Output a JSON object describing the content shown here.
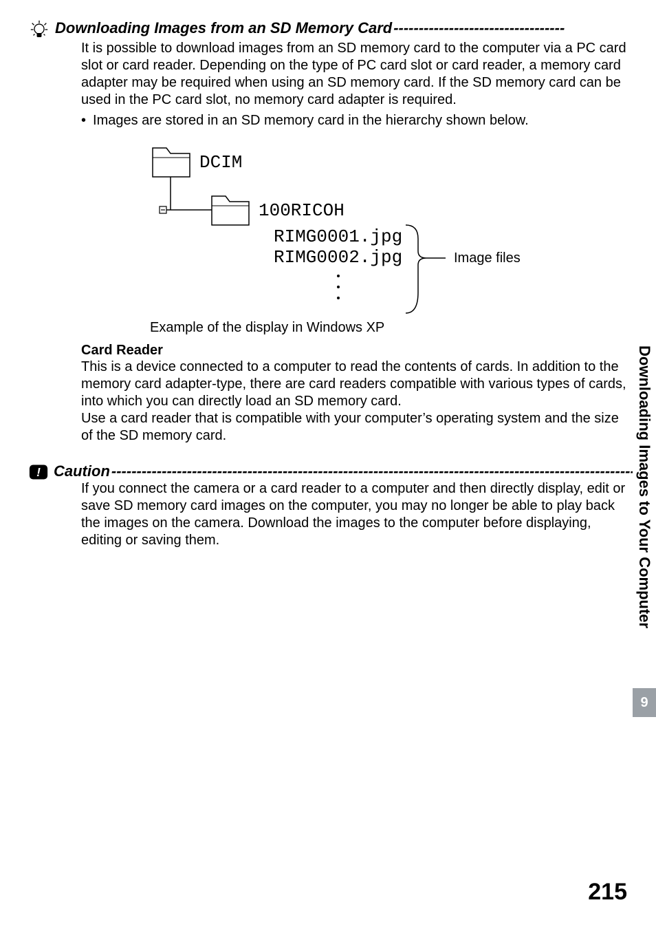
{
  "tip": {
    "heading": "Downloading Images from an SD Memory Card",
    "body": "It is possible to download images from an SD memory card to the computer via a PC card slot or card reader. Depending on the type of PC card slot or card reader, a memory card adapter may be required when using an SD memory card. If the SD memory card can be used in the PC card slot, no memory card adapter is required.",
    "bullet": "Images are stored in an SD memory card in the hierarchy shown below."
  },
  "diagram": {
    "folder_root": "DCIM",
    "folder_sub": "100RICOH",
    "file1": "RIMG0001.jpg",
    "file2": "RIMG0002.jpg",
    "label_files": "Image files",
    "caption": "Example of the display in Windows XP"
  },
  "card_reader": {
    "heading": "Card Reader",
    "body1": "This is a device connected to a computer to read the contents of cards. In addition to the memory card adapter-type, there are card readers compatible with various types of cards, into which you can directly load an SD memory card.",
    "body2": "Use a card reader that is compatible with your computer’s operating system and the size of the SD memory card."
  },
  "caution": {
    "heading": "Caution",
    "body": "If you connect the camera or a card reader to a computer and then directly display, edit or save SD memory card images on the computer, you may no longer be able to play back the images on the camera. Download the images to the computer before displaying, editing or saving them."
  },
  "sidebar": {
    "label": "Downloading Images to Your Computer",
    "chapter": "9"
  },
  "page_number": "215",
  "dash_fill_long": "-----------------------------------------------------------------------------------------------------------",
  "dash_fill_short": "----------------------------------"
}
